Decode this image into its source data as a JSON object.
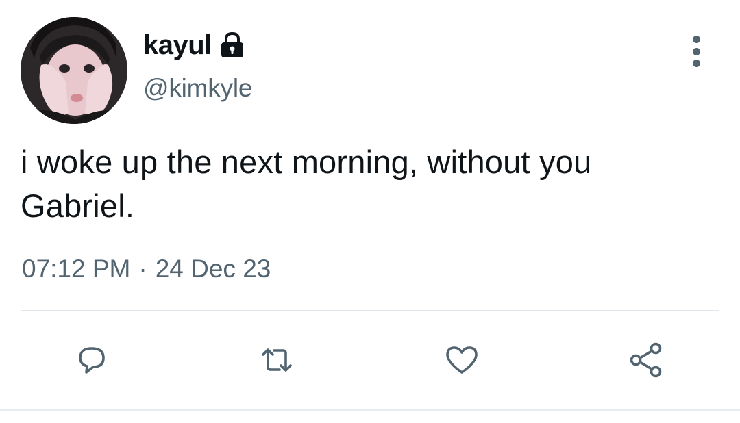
{
  "user": {
    "display_name": "kayul",
    "handle": "@kimkyle",
    "protected_icon": "lock-icon",
    "avatar": "profile-photo"
  },
  "tweet": {
    "text": "i woke up the next morning, without you\nGabriel.",
    "time": "07:12 PM",
    "separator": "·",
    "date": "24 Dec 23"
  },
  "actions": [
    {
      "name": "reply",
      "icon": "reply-icon"
    },
    {
      "name": "retweet",
      "icon": "retweet-icon"
    },
    {
      "name": "like",
      "icon": "heart-icon"
    },
    {
      "name": "share",
      "icon": "share-icon"
    }
  ],
  "colors": {
    "text_primary": "#0f1419",
    "text_secondary": "#536471",
    "divider": "#e1e6ea",
    "background": "#ffffff"
  }
}
